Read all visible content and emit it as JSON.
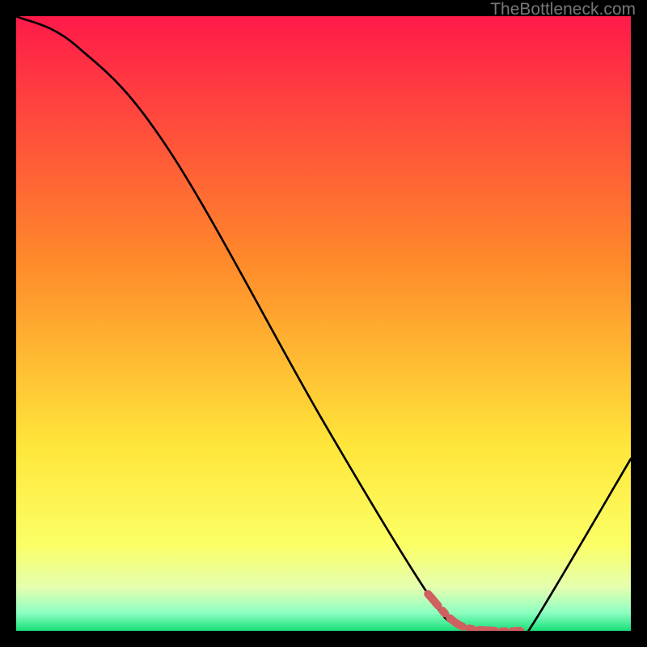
{
  "watermark": "TheBottleneck.com",
  "chart_data": {
    "type": "line",
    "title": "",
    "xlabel": "",
    "ylabel": "",
    "xlim": [
      0,
      100
    ],
    "ylim": [
      0,
      100
    ],
    "series": [
      {
        "name": "curve",
        "x": [
          0,
          10,
          25,
          50,
          67,
          72,
          78,
          82,
          84,
          100
        ],
        "values": [
          100,
          95,
          78,
          34,
          6,
          1,
          0,
          0,
          1,
          28
        ]
      },
      {
        "name": "highlight-segment",
        "x": [
          67,
          72,
          78,
          82
        ],
        "values": [
          6,
          1,
          0,
          0
        ]
      }
    ],
    "gradient_stops": [
      {
        "pct": 0,
        "color": "#ff1a4a"
      },
      {
        "pct": 40,
        "color": "#ff8a2a"
      },
      {
        "pct": 70,
        "color": "#ffe63a"
      },
      {
        "pct": 86,
        "color": "#fbff66"
      },
      {
        "pct": 93,
        "color": "#e4ffb0"
      },
      {
        "pct": 97,
        "color": "#8fffc2"
      },
      {
        "pct": 100,
        "color": "#18e07a"
      }
    ]
  }
}
